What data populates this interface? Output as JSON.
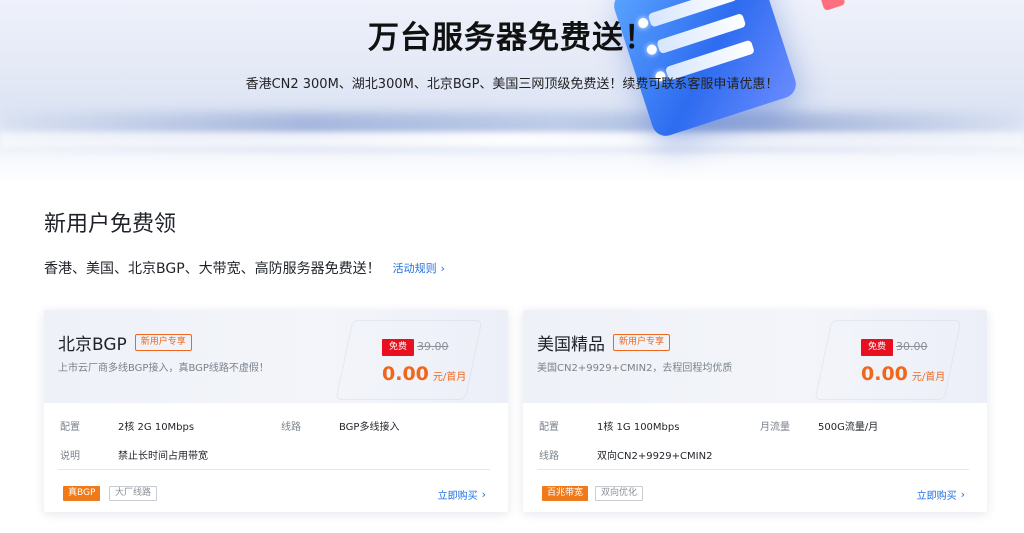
{
  "hero": {
    "title": "万台服务器免费送！",
    "subtitle": "香港CN2 300M、湖北300M、北京BGP、美国三网顶级免费送！续费可联系客服申请优惠！"
  },
  "section": {
    "title": "新用户免费领",
    "description": "香港、美国、北京BGP、大带宽、高防服务器免费送！",
    "rules_link": "活动规则",
    "rules_icon": "chevron-right-icon"
  },
  "cards": [
    {
      "name": "北京BGP",
      "new_tag": "新用户专享",
      "subtitle": "上市云厂商多线BGP接入，真BGP线路不虚假！",
      "free_badge": "免费",
      "original_price": "39.00",
      "price": "0.00",
      "price_unit": "元/首月",
      "specs": [
        {
          "key": "配置",
          "value": "2核 2G 10Mbps"
        },
        {
          "key": "线路",
          "value": "BGP多线接入"
        },
        {
          "key": "说明",
          "value": "禁止长时间占用带宽"
        }
      ],
      "tags": [
        "真BGP",
        "大厂线路"
      ],
      "buy_label": "立即购买"
    },
    {
      "name": "美国精品",
      "new_tag": "新用户专享",
      "subtitle": "美国CN2+9929+CMIN2，去程回程均优质",
      "free_badge": "免费",
      "original_price": "30.00",
      "price": "0.00",
      "price_unit": "元/首月",
      "specs": [
        {
          "key": "配置",
          "value": "1核 1G 100Mbps"
        },
        {
          "key": "月流量",
          "value": "500G流量/月"
        },
        {
          "key": "线路",
          "value": "双向CN2+9929+CMIN2"
        }
      ],
      "tags": [
        "百兆带宽",
        "双向优化"
      ],
      "buy_label": "立即购买"
    }
  ],
  "colors": {
    "accent_orange": "#f0671c",
    "free_red": "#e8101e",
    "link_blue": "#1f6fe5"
  }
}
